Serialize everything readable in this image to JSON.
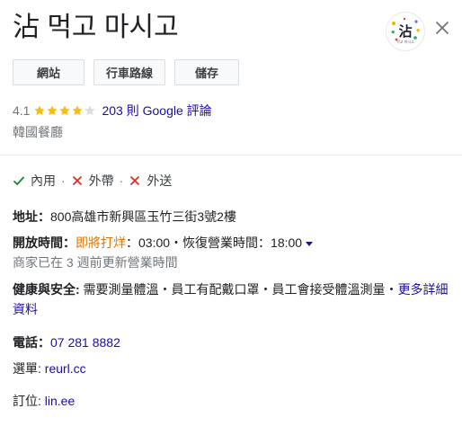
{
  "place": {
    "title": "沾 먹고 마시고",
    "logo_text": "沾",
    "logo_subtext": "먹고 마시고"
  },
  "actions": {
    "website_label": "網站",
    "directions_label": "行車路線",
    "save_label": "儲存"
  },
  "rating": {
    "value": "4.1",
    "stars_filled": 4,
    "stars_total": 5,
    "reviews_label": "203 則 Google 評論"
  },
  "category": "韓國餐廳",
  "services": {
    "dine_in": "內用",
    "takeout": "外帶",
    "delivery": "外送",
    "separator": "·"
  },
  "address": {
    "label": "地址：",
    "value": "800高雄市新興區玉竹三街3號2樓"
  },
  "hours": {
    "label": "開放時間：",
    "status": "即將打烊",
    "detail": "：03:00・恢復營業時間：18:00",
    "update_note": "商家已在 3 週前更新營業時間"
  },
  "health": {
    "label": "健康與安全:",
    "text_line1": " 需要測量體溫・員工有配戴口罩・員工會接受體溫測量・",
    "more_part1": "更多詳細",
    "more_part2": "資料"
  },
  "phone": {
    "label": "電話：",
    "value": "07 281 8882"
  },
  "menu": {
    "label": "選單:",
    "value": "reurl.cc"
  },
  "order": {
    "label": "訂位:",
    "value": "lin.ee"
  },
  "colors": {
    "link": "#1a0dab",
    "star": "#fbbc04",
    "check": "#188038",
    "cross": "#d93025",
    "closing": "#e37400"
  },
  "icons": {
    "close": "close-icon",
    "check": "check-icon",
    "cross": "cross-icon",
    "star": "star-icon",
    "dropdown": "caret-down-icon"
  }
}
